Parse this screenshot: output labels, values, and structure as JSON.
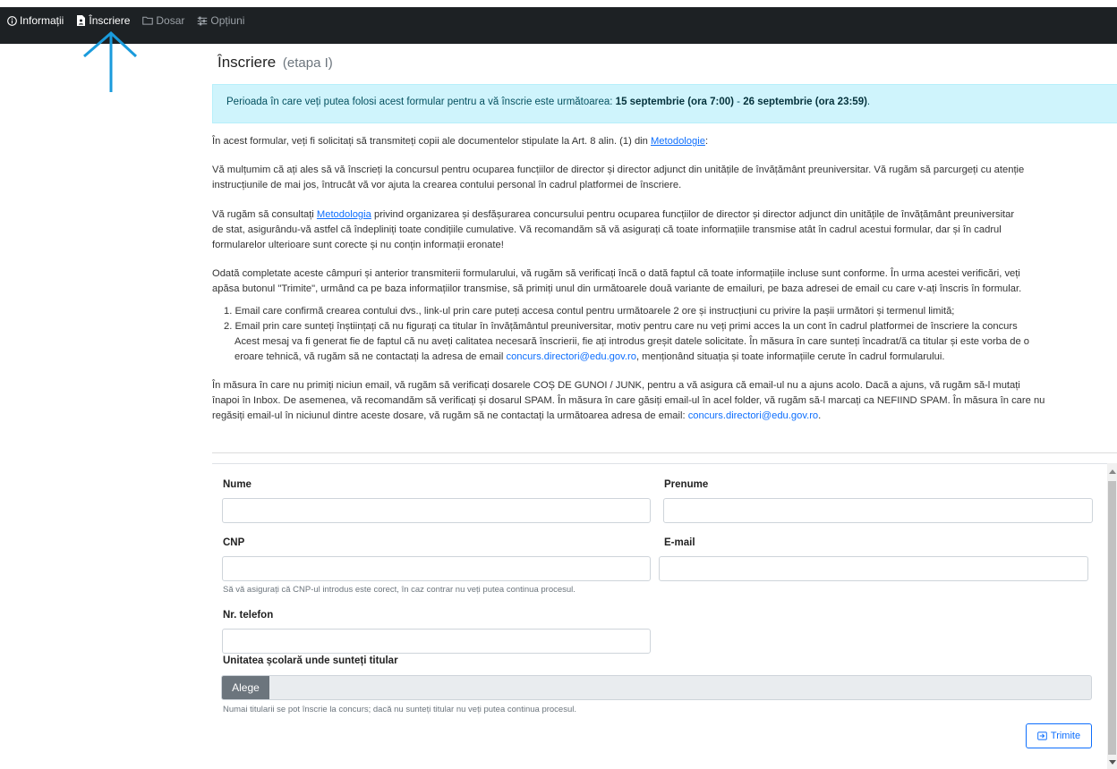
{
  "nav": {
    "items": [
      {
        "label": "Informații",
        "icon": "info-circle-icon"
      },
      {
        "label": "Înscriere",
        "icon": "file-person-icon"
      },
      {
        "label": "Dosar",
        "icon": "folder-icon"
      },
      {
        "label": "Opțiuni",
        "icon": "sliders-icon"
      }
    ]
  },
  "page": {
    "title": "Înscriere",
    "stage": "(etapa I)"
  },
  "alert": {
    "prefix": "Perioada în care veți putea folosi acest formular pentru a vă înscrie este următoarea: ",
    "start": "15 septembrie (ora 7:00)",
    "separator": " - ",
    "end": "26 septembrie (ora 23:59)",
    "suffix": "."
  },
  "intro": {
    "p1_text": "În acest formular, veți fi solicitați să transmiteți copii ale documentelor stipulate la Art. 8 alin. (1) din ",
    "p1_link": "Metodologie",
    "p1_end": ":",
    "p2_line1": "Vă mulțumim că ați ales să vă înscrieți la concursul pentru ocuparea funcțiilor de director și director adjunct din unitățile de învățământ preuniversitar. Vă rugăm să parcurgeți cu atenție",
    "p2_line2": "instrucțiunile de mai jos, întrucât vă vor ajuta la crearea contului personal în cadrul platformei de înscriere.",
    "p3_start": "Vă rugăm să consultați ",
    "p3_link": "Metodologia",
    "p3_line1_rest": " privind organizarea și desfășurarea concursului pentru ocuparea funcțiilor de director și director adjunct din unitățile de învățământ preuniversitar",
    "p3_line2": "de stat, asigurându-vă astfel că îndepliniți toate condițiile cumulative. Vă recomandăm să vă asigurați că toate informațiile transmise atât în cadrul acestui formular, dar și în cadrul",
    "p3_line3": "formularelor ulterioare sunt corecte și nu conțin informații eronate!",
    "p4_line1": "Odată completate aceste câmpuri și anterior transmiterii formularului, vă rugăm să verificați încă o dată faptul că toate informațiile incluse sunt conforme. În urma acestei verificări, veți",
    "p4_line2": "apăsa butonul \"Trimite\", urmând ca pe baza informațiilor transmise, să primiți unul din următoarele două variante de emailuri, pe baza adresei de email cu care v-ați înscris în formular.",
    "li1": "1. Email care confirmă crearea contului dvs., link-ul prin care puteți accesa contul pentru următoarele 2 ore și instrucțiuni cu privire la pașii următori și termenul limită;",
    "li2_line1": "2. Email prin care sunteți înștiințați că nu figurați ca titular în învățământul preuniversitar, motiv pentru care nu veți primi acces la un cont în cadrul platformei de înscriere la concurs",
    "li2_line2": "Acest mesaj va fi generat fie de faptul că nu aveți calitatea necesară înscrierii, fie ați introdus greșit datele solicitate. În măsura în care sunteți încadrat/ă ca titular și este vorba de o",
    "li2_line3_start": "eroare tehnică, vă rugăm să ne contactați la adresa de email ",
    "li2_email": "concurs.directori@edu.gov.ro",
    "li2_line3_end": ", menționând situația și toate informațiile cerute în cadrul formularului.",
    "p5_line1": "În măsura în care nu primiți niciun email, vă rugăm să verificați dosarele COȘ DE GUNOI / JUNK, pentru a vă asigura că email-ul nu a ajuns acolo. Dacă a ajuns, vă rugăm să-l mutați",
    "p5_line2": "înapoi în Inbox. De asemenea, vă recomandăm să verificați și dosarul SPAM. În măsura în care găsiți email-ul în acel folder, vă rugăm să-l marcați ca NEFIIND SPAM. În măsura în care nu",
    "p5_line3_start": "regăsiți email-ul în niciunul dintre aceste dosare, vă rugăm să ne contactați la următoarea adresa de email: ",
    "p5_email": "concurs.directori@edu.gov.ro",
    "p5_line3_end": "."
  },
  "form": {
    "nume_label": "Nume",
    "nume_value": "",
    "prenume_label": "Prenume",
    "prenume_value": "",
    "cnp_label": "CNP",
    "cnp_value": "",
    "cnp_help": "Să vă asigurați că CNP-ul introdus este corect, în caz contrar nu veți putea continua procesul.",
    "email_label": "E-mail",
    "email_value": "",
    "phone_label": "Nr. telefon",
    "phone_value": "",
    "unit_label": "Unitatea școlară unde sunteți titular",
    "unit_button": "Alege",
    "unit_help": "Numai titularii se pot înscrie la concurs; dacă nu sunteți titular nu veți putea continua procesul.",
    "submit_label": "Trimite"
  },
  "colors": {
    "nav_bg": "#1d2124",
    "alert_bg": "#cff4fc",
    "link": "#0d6efd",
    "arrow": "#1a9bdc",
    "select_button": "#6c757d"
  }
}
